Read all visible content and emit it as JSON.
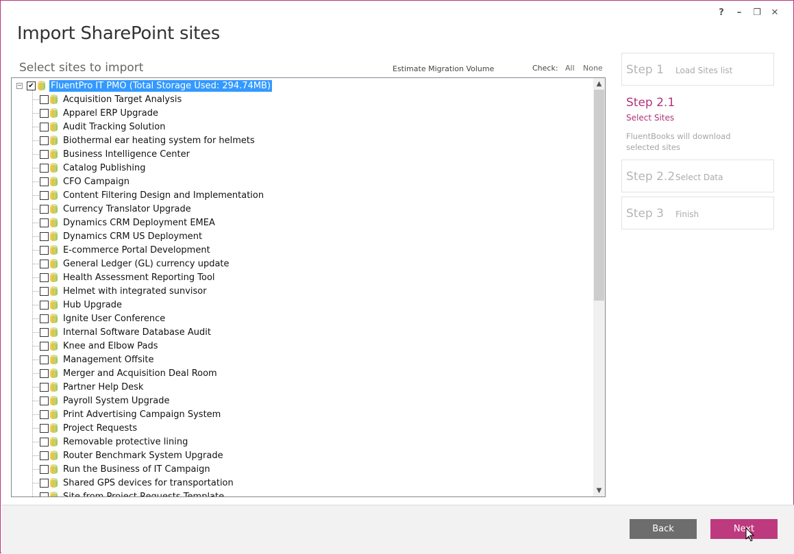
{
  "window": {
    "controls": {
      "help": "?",
      "minimize": "–",
      "restore": "❐",
      "close": "✕"
    }
  },
  "page_title": "Import SharePoint sites",
  "section_title": "Select sites to import",
  "toolbar": {
    "estimate_label": "Estimate Migration Volume",
    "check_label": "Check:",
    "check_all": "All",
    "check_none": "None"
  },
  "tree": {
    "root": {
      "label": "FluentPro IT PMO (Total Storage Used: 294.74MB)",
      "checked": true,
      "expanded": true
    },
    "items": [
      "Acquisition Target Analysis",
      "Apparel ERP Upgrade",
      "Audit Tracking Solution",
      "Biothermal ear heating system for helmets",
      "Business Intelligence Center",
      "Catalog Publishing",
      "CFO Campaign",
      "Content Filtering Design and Implementation",
      "Currency Translator Upgrade",
      "Dynamics CRM Deployment EMEA",
      "Dynamics CRM US Deployment",
      "E-commerce Portal Development",
      "General Ledger (GL) currency update",
      "Health Assessment Reporting Tool",
      "Helmet with integrated sunvisor",
      "Hub Upgrade",
      "Ignite User Conference",
      "Internal Software Database Audit",
      "Knee and Elbow Pads",
      "Management Offsite",
      "Merger and Acquisition Deal Room",
      "Partner Help Desk",
      "Payroll System Upgrade",
      "Print Advertising Campaign System",
      "Project Requests",
      "Removable protective lining",
      "Router Benchmark System Upgrade",
      "Run the Business of IT Campaign",
      "Shared GPS devices for transportation",
      "Site from Project Requests Template"
    ]
  },
  "steps": {
    "step1": {
      "num": "Step 1",
      "name": "Load Sites list"
    },
    "step21": {
      "num": "Step 2.1",
      "name": "Select Sites",
      "desc": "FluentBooks will download selected sites"
    },
    "step22": {
      "num": "Step 2.2",
      "name": "Select Data"
    },
    "step3": {
      "num": "Step 3",
      "name": "Finish"
    }
  },
  "footer": {
    "back": "Back",
    "next": "Next"
  },
  "colors": {
    "accent": "#be3a7e",
    "active_step": "#b0337a",
    "selection": "#3399ff",
    "back_button": "#6d6d6d"
  }
}
